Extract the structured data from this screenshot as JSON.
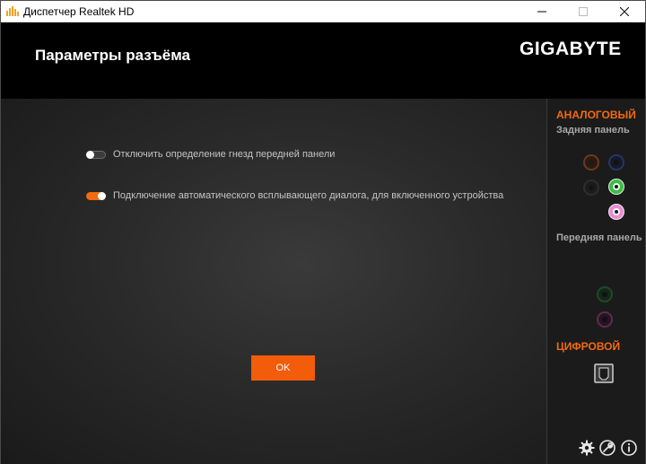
{
  "window": {
    "title": "Диспетчер Realtek HD"
  },
  "header": {
    "title": "Параметры разъёма",
    "brand": "GIGABYTE"
  },
  "options": [
    {
      "label": "Отключить определение гнезд передней панели",
      "enabled": false
    },
    {
      "label": "Подключение автоматического всплывающего диалога, для включенного устройства",
      "enabled": true
    }
  ],
  "ok_button": {
    "label": "OK"
  },
  "sidebar": {
    "analog_heading": "АНАЛОГОВЫЙ",
    "rear_panel_label": "Задняя панель",
    "front_panel_label": "Передняя панель",
    "digital_heading": "ЦИФРОВОЙ",
    "rear_jacks": [
      {
        "name": "orange-jack",
        "color": "#6a3a20",
        "active": false
      },
      {
        "name": "blue-jack",
        "color": "#27365c",
        "active": false
      },
      {
        "name": "black-jack",
        "color": "#2a2a2a",
        "active": false
      },
      {
        "name": "green-jack",
        "color": "#3fb948",
        "active": true
      },
      {
        "name": "pink-jack",
        "color": "#e58fd0",
        "active": true
      }
    ],
    "front_jacks": [
      {
        "name": "green-jack",
        "color": "#1f4a24",
        "active": false
      },
      {
        "name": "pink-jack",
        "color": "#5a2f4a",
        "active": false
      }
    ]
  },
  "colors": {
    "accent": "#f36a10",
    "background": "#1e1e1e",
    "header": "#000000"
  },
  "icons": [
    "app-speaker-icon",
    "settings-gear-icon",
    "wrench-icon",
    "info-icon"
  ]
}
